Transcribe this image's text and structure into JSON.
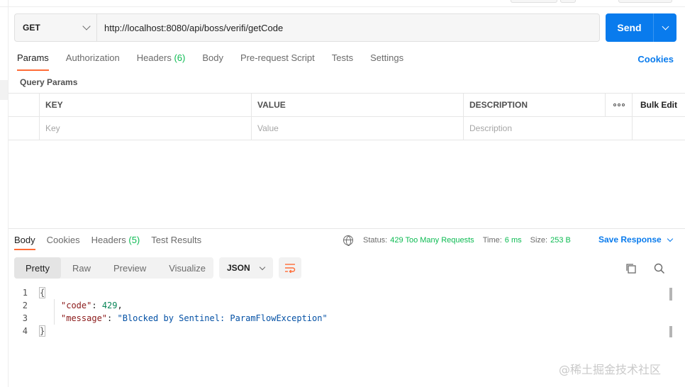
{
  "request": {
    "method": "GET",
    "url": "http://localhost:8080/api/boss/verifi/getCode",
    "send_label": "Send"
  },
  "request_tabs": [
    {
      "label": "Params",
      "count": "",
      "active": true
    },
    {
      "label": "Authorization",
      "count": "",
      "active": false
    },
    {
      "label": "Headers",
      "count": "(6)",
      "active": false
    },
    {
      "label": "Body",
      "count": "",
      "active": false
    },
    {
      "label": "Pre-request Script",
      "count": "",
      "active": false
    },
    {
      "label": "Tests",
      "count": "",
      "active": false
    },
    {
      "label": "Settings",
      "count": "",
      "active": false
    }
  ],
  "cookies_label": "Cookies",
  "query_params": {
    "title": "Query Params",
    "headers": {
      "key": "KEY",
      "value": "VALUE",
      "description": "DESCRIPTION",
      "bulk_edit": "Bulk Edit"
    },
    "placeholders": {
      "key": "Key",
      "value": "Value",
      "description": "Description"
    }
  },
  "response_tabs": [
    {
      "label": "Body",
      "count": "",
      "active": true
    },
    {
      "label": "Cookies",
      "count": "",
      "active": false
    },
    {
      "label": "Headers",
      "count": "(5)",
      "active": false
    },
    {
      "label": "Test Results",
      "count": "",
      "active": false
    }
  ],
  "response_status": {
    "status_label": "Status:",
    "status_value": "429 Too Many Requests",
    "time_label": "Time:",
    "time_value": "6 ms",
    "size_label": "Size:",
    "size_value": "253 B",
    "save_label": "Save Response"
  },
  "view_tabs": [
    {
      "label": "Pretty",
      "active": true
    },
    {
      "label": "Raw",
      "active": false
    },
    {
      "label": "Preview",
      "active": false
    },
    {
      "label": "Visualize",
      "active": false
    }
  ],
  "format": "JSON",
  "body_lines": {
    "n1": "1",
    "n2": "2",
    "n3": "3",
    "n4": "4",
    "open": "{",
    "close": "}",
    "key1": "\"code\"",
    "val1": "429",
    "key2": "\"message\"",
    "val2": "\"Blocked by Sentinel: ParamFlowException\""
  },
  "colors": {
    "accent": "#097bed",
    "tab_indicator": "#ff6c37",
    "status_ok": "#0cbb52"
  },
  "watermark": "@稀土掘金技术社区"
}
